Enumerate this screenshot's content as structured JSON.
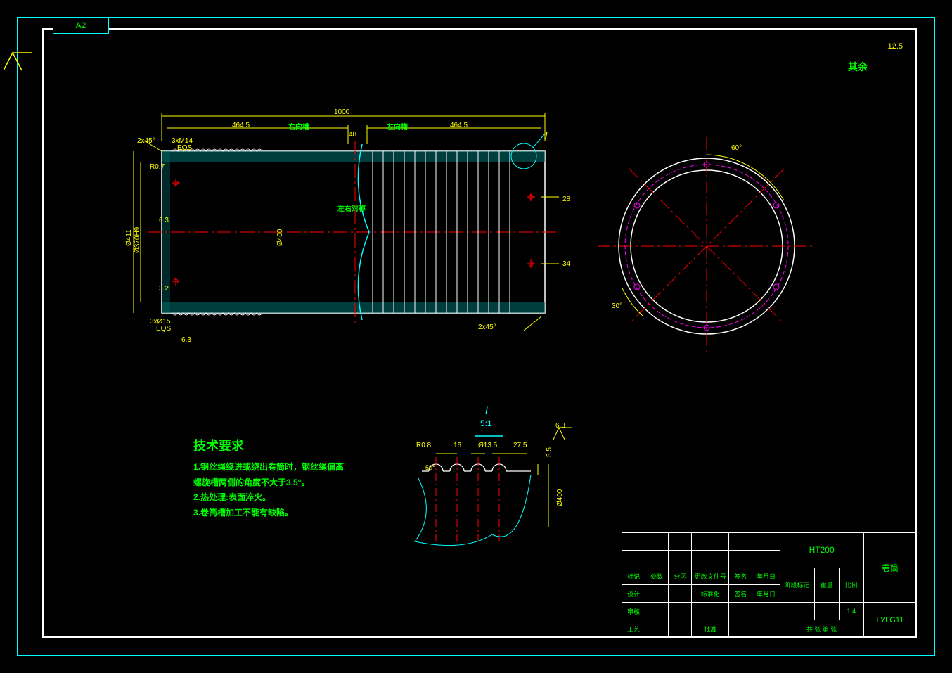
{
  "sheet": {
    "format": "A2"
  },
  "surface_finish": {
    "general_label": "其余",
    "general_value": "12.5",
    "local_63": "6.3"
  },
  "front_view": {
    "total_length": "1000",
    "groove_right_label": "右向槽",
    "groove_left_label": "左向槽",
    "groove_len_left": "464.5",
    "groove_len_right": "464.5",
    "symmetry_label": "左右对称",
    "mid_gap": "48",
    "chamfer_left": "2x45°",
    "chamfer_right": "2x45°",
    "hole_spec_top": "3xM14",
    "hole_eqs_top": "EQS",
    "hole_spec_bot": "3xØ15",
    "hole_eqs_bot": "EQS",
    "hole_edge_dist": "28",
    "hole_edge_dist2": "34",
    "dia_outer": "Ø411",
    "dia_inner": "Ø370H9",
    "dia_groove": "Ø400",
    "radius_small": "R0.7",
    "finish_left_32": "3.2",
    "finish_left_63": "6.3",
    "detail_callout": "I"
  },
  "end_view": {
    "angle_top": "60°",
    "angle_bot": "30°"
  },
  "detail_view": {
    "name": "I",
    "scale": "5:1",
    "radius": "R0.8",
    "pitch": "16",
    "groove_dia": "Ø13.5",
    "width": "27.5",
    "depth": "5.5",
    "inner_dia_ref": "Ø400",
    "relief_angle": "50°",
    "surface_finish": "6.3"
  },
  "tech_requirements": {
    "header": "技术要求",
    "items": [
      "1.钢丝绳绕进或绕出卷筒时，钢丝绳偏离螺旋槽两侧的角度不大于3.5°。",
      "2.热处理:表面淬火。",
      "3.卷筒槽加工不能有缺陷。"
    ]
  },
  "title_block": {
    "material": "HT200",
    "part_name": "卷筒",
    "drawing_no": "LYLG11",
    "scale": "1:4",
    "row_mark": "标记",
    "row_count": "处数",
    "row_zone": "分区",
    "row_file": "更改文件号",
    "row_sign": "签名",
    "row_date": "年月日",
    "row_design": "设计",
    "row_std": "标准化",
    "row_check": "审核",
    "row_process": "工艺",
    "row_approve": "批准",
    "stage_mark": "阶段标记",
    "weight": "重量",
    "scale_lbl": "比例",
    "sheet_total": "共  张  第  张"
  }
}
